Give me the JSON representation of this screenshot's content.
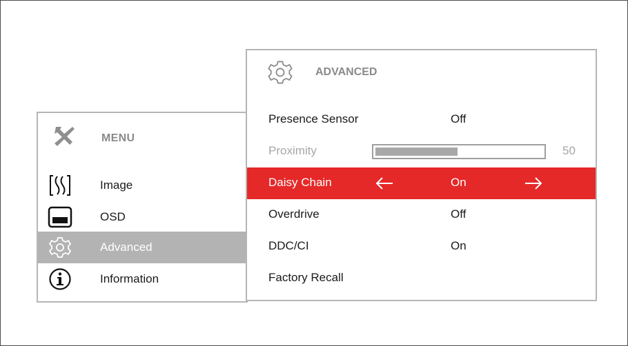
{
  "menu": {
    "title": "MENU",
    "items": [
      {
        "label": "Image",
        "icon": "image-waves-icon",
        "active": false
      },
      {
        "label": "OSD",
        "icon": "osd-window-icon",
        "active": false
      },
      {
        "label": "Advanced",
        "icon": "gear-icon",
        "active": true
      },
      {
        "label": "Information",
        "icon": "info-icon",
        "active": false
      }
    ]
  },
  "submenu": {
    "title": "ADVANCED",
    "rows": [
      {
        "name": "Presence Sensor",
        "value": "Off"
      },
      {
        "name": "Proximity",
        "value": "50",
        "slider_level": 0.5,
        "disabled": true
      },
      {
        "name": "Daisy Chain",
        "value": "On",
        "selected": true
      },
      {
        "name": "Overdrive",
        "value": "Off"
      },
      {
        "name": "DDC/CI",
        "value": "On"
      },
      {
        "name": "Factory Recall",
        "value": ""
      }
    ]
  },
  "colors": {
    "selected_row": "#e52828",
    "active_menu_item": "#b3b3b3",
    "header_text": "#8a8a8a",
    "disabled_text": "#a6a6a6"
  }
}
